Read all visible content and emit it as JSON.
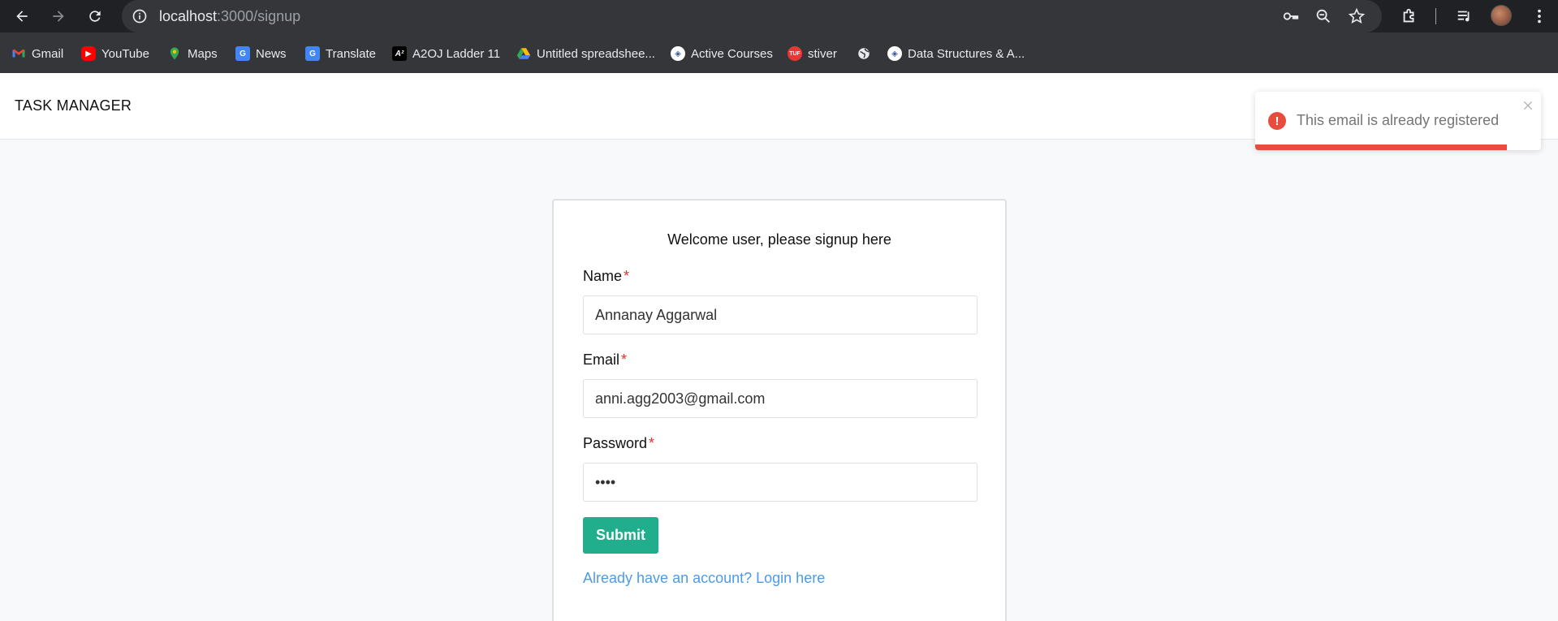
{
  "browser": {
    "url_host": "localhost",
    "url_path": ":3000/signup"
  },
  "bookmarks": [
    {
      "label": "Gmail",
      "icon": "gmail-icon",
      "color": "#ea4335"
    },
    {
      "label": "YouTube",
      "icon": "youtube-icon",
      "color": "#ff0000"
    },
    {
      "label": "Maps",
      "icon": "maps-icon",
      "color": "#34a853"
    },
    {
      "label": "News",
      "icon": "news-icon",
      "color": "#4285f4"
    },
    {
      "label": "Translate",
      "icon": "translate-icon",
      "color": "#4285f4"
    },
    {
      "label": "A2OJ Ladder 11",
      "icon": "a2oj-icon",
      "color": "#000000"
    },
    {
      "label": "Untitled spreadshee...",
      "icon": "drive-icon",
      "color": "#fbbc04"
    },
    {
      "label": "Active Courses",
      "icon": "courses-icon",
      "color": "#3b5998"
    },
    {
      "label": "stiver",
      "icon": "tuf-icon",
      "color": "#e53935"
    },
    {
      "label": "",
      "icon": "globe-icon",
      "color": "#9aa0a6"
    },
    {
      "label": "Data Structures & A...",
      "icon": "courses-icon",
      "color": "#3b5998"
    }
  ],
  "app": {
    "title": "TASK MANAGER"
  },
  "form": {
    "heading": "Welcome user, please signup here",
    "name_label": "Name",
    "name_value": "Annanay Aggarwal",
    "email_label": "Email",
    "email_value": "anni.agg2003@gmail.com",
    "password_label": "Password",
    "password_value": "••••",
    "required_mark": "*",
    "submit_label": "Submit",
    "login_link": "Already have an account? Login here"
  },
  "toast": {
    "message": "This email is already registered",
    "icon": "!",
    "progress_fraction": 0.88,
    "color": "#e74c3c"
  },
  "colors": {
    "accent": "#20ae8d",
    "link": "#4c9be8",
    "error": "#e74c3c"
  }
}
